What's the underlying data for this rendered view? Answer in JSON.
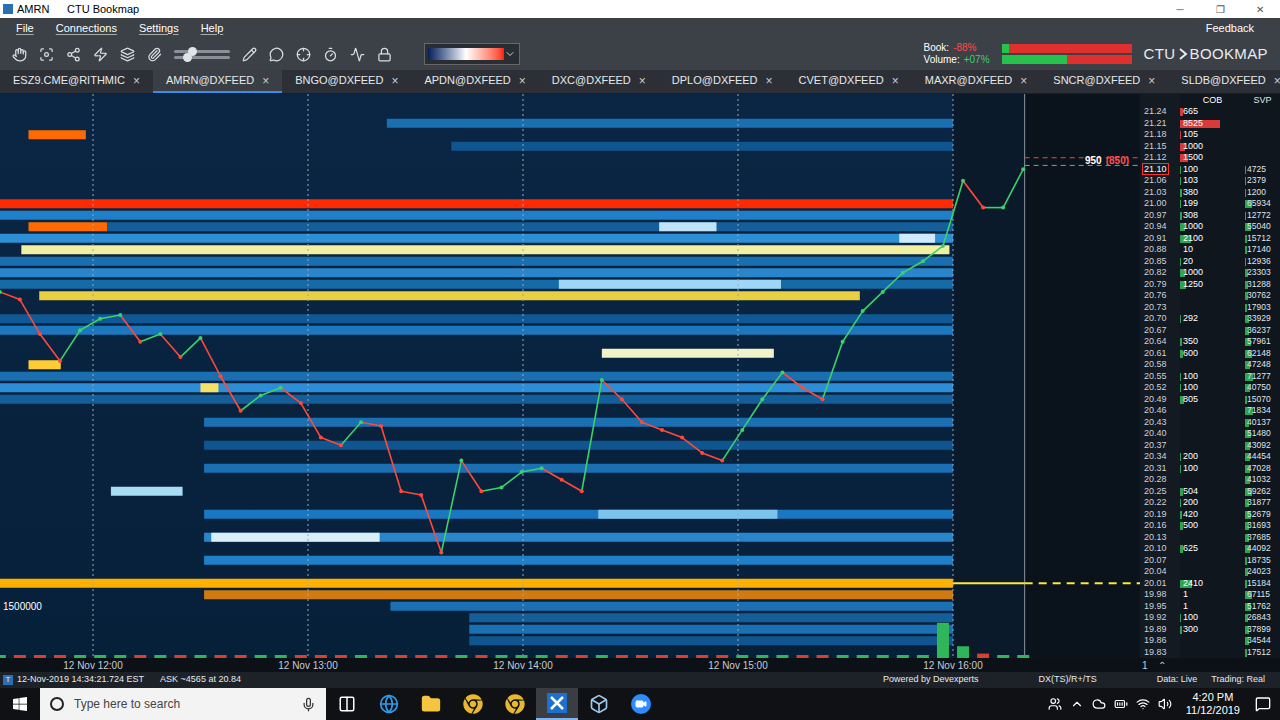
{
  "window": {
    "title": "AMRN",
    "app": "CTU Bookmap",
    "controls": [
      "─",
      "❐",
      "✕"
    ]
  },
  "menu": {
    "items": [
      "File",
      "Connections",
      "Settings",
      "Help"
    ],
    "feedback": "Feedback"
  },
  "toolbar": {
    "sliders": [
      {
        "level": 0.3
      },
      {
        "level": 0.2
      }
    ],
    "book_label": "Book:",
    "book_value": "-88%",
    "volume_label": "Volume:",
    "volume_value": "+07%",
    "book_buy_level": 0.06,
    "volume_buy_level": 0.5,
    "logo_left": "CTU",
    "logo_right": "BOOKMAP"
  },
  "tabs": [
    {
      "label": "ESZ9.CME@RITHMIC",
      "selected": false
    },
    {
      "label": "AMRN@DXFEED",
      "selected": true
    },
    {
      "label": "BNGO@DXFEED",
      "selected": false
    },
    {
      "label": "APDN@DXFEED",
      "selected": false
    },
    {
      "label": "DXC@DXFEED",
      "selected": false
    },
    {
      "label": "DPLO@DXFEED",
      "selected": false
    },
    {
      "label": "CVET@DXFEED",
      "selected": false
    },
    {
      "label": "MAXR@DXFEED",
      "selected": false
    },
    {
      "label": "SNCR@DXFEED",
      "selected": false
    },
    {
      "label": "SLDB@DXFEED",
      "selected": false
    }
  ],
  "tab_close": "×",
  "tab_add": "+",
  "ladder": {
    "headers": [
      "COB",
      "SVP"
    ],
    "rows": [
      {
        "price": "21.24",
        "cob": "665",
        "svp": "",
        "side": "ask",
        "highlight": false
      },
      {
        "price": "21.21",
        "cob": "8525",
        "svp": "",
        "side": "ask",
        "highlight": false
      },
      {
        "price": "21.18",
        "cob": "105",
        "svp": "",
        "side": "ask",
        "highlight": false
      },
      {
        "price": "21.15",
        "cob": "1000",
        "svp": "",
        "side": "ask",
        "highlight": false
      },
      {
        "price": "21.12",
        "cob": "1500",
        "svp": "",
        "side": "ask",
        "highlight": false
      },
      {
        "price": "21.10",
        "cob": "100",
        "svp": "4725",
        "side": "bid",
        "highlight": true
      },
      {
        "price": "21.06",
        "cob": "103",
        "svp": "2379",
        "side": "bid",
        "highlight": false
      },
      {
        "price": "21.03",
        "cob": "380",
        "svp": "1200",
        "side": "bid",
        "highlight": false
      },
      {
        "price": "21.00",
        "cob": "199",
        "svp": "65934",
        "side": "bid",
        "highlight": false
      },
      {
        "price": "20.97",
        "cob": "308",
        "svp": "12772",
        "side": "bid",
        "highlight": false
      },
      {
        "price": "20.94",
        "cob": "1000",
        "svp": "55040",
        "side": "bid",
        "highlight": false
      },
      {
        "price": "20.91",
        "cob": "2100",
        "svp": "15712",
        "side": "bid",
        "highlight": false
      },
      {
        "price": "20.88",
        "cob": "10",
        "svp": "17140",
        "side": "bid",
        "highlight": false
      },
      {
        "price": "20.85",
        "cob": "20",
        "svp": "12936",
        "side": "bid",
        "highlight": false
      },
      {
        "price": "20.82",
        "cob": "1000",
        "svp": "23303",
        "side": "bid",
        "highlight": false
      },
      {
        "price": "20.79",
        "cob": "1250",
        "svp": "31288",
        "side": "bid",
        "highlight": false
      },
      {
        "price": "20.76",
        "cob": "",
        "svp": "30762",
        "side": "bid",
        "highlight": false
      },
      {
        "price": "20.73",
        "cob": "",
        "svp": "17903",
        "side": "bid",
        "highlight": false
      },
      {
        "price": "20.70",
        "cob": "292",
        "svp": "33929",
        "side": "bid",
        "highlight": false
      },
      {
        "price": "20.67",
        "cob": "",
        "svp": "36237",
        "side": "bid",
        "highlight": false
      },
      {
        "price": "20.64",
        "cob": "350",
        "svp": "57961",
        "side": "bid",
        "highlight": false
      },
      {
        "price": "20.61",
        "cob": "600",
        "svp": "62148",
        "side": "bid",
        "highlight": false
      },
      {
        "price": "20.58",
        "cob": "",
        "svp": "47248",
        "side": "bid",
        "highlight": false
      },
      {
        "price": "20.55",
        "cob": "100",
        "svp": "71277",
        "side": "bid",
        "highlight": false
      },
      {
        "price": "20.52",
        "cob": "100",
        "svp": "40750",
        "side": "bid",
        "highlight": false
      },
      {
        "price": "20.49",
        "cob": "805",
        "svp": "15070",
        "side": "bid",
        "highlight": false
      },
      {
        "price": "20.46",
        "cob": "",
        "svp": "71834",
        "side": "bid",
        "highlight": false
      },
      {
        "price": "20.43",
        "cob": "",
        "svp": "40137",
        "side": "bid",
        "highlight": false
      },
      {
        "price": "20.40",
        "cob": "",
        "svp": "51480",
        "side": "bid",
        "highlight": false
      },
      {
        "price": "20.37",
        "cob": "",
        "svp": "43092",
        "side": "bid",
        "highlight": false
      },
      {
        "price": "20.34",
        "cob": "200",
        "svp": "44454",
        "side": "bid",
        "highlight": false
      },
      {
        "price": "20.31",
        "cob": "100",
        "svp": "47028",
        "side": "bid",
        "highlight": false
      },
      {
        "price": "20.28",
        "cob": "",
        "svp": "41032",
        "side": "bid",
        "highlight": false
      },
      {
        "price": "20.25",
        "cob": "504",
        "svp": "59262",
        "side": "bid",
        "highlight": false
      },
      {
        "price": "20.22",
        "cob": "200",
        "svp": "31877",
        "side": "bid",
        "highlight": false
      },
      {
        "price": "20.19",
        "cob": "420",
        "svp": "52679",
        "side": "bid",
        "highlight": false
      },
      {
        "price": "20.16",
        "cob": "500",
        "svp": "31693",
        "side": "bid",
        "highlight": false
      },
      {
        "price": "20.13",
        "cob": "",
        "svp": "37685",
        "side": "bid",
        "highlight": false
      },
      {
        "price": "20.10",
        "cob": "625",
        "svp": "44092",
        "side": "bid",
        "highlight": false
      },
      {
        "price": "20.07",
        "cob": "",
        "svp": "18735",
        "side": "bid",
        "highlight": false
      },
      {
        "price": "20.04",
        "cob": "",
        "svp": "24023",
        "side": "bid",
        "highlight": false
      },
      {
        "price": "20.01",
        "cob": "2410",
        "svp": "15184",
        "side": "bid",
        "highlight": false
      },
      {
        "price": "19.98",
        "cob": "1",
        "svp": "67115",
        "side": "bid",
        "highlight": false
      },
      {
        "price": "19.95",
        "cob": "1",
        "svp": "51762",
        "side": "bid",
        "highlight": false
      },
      {
        "price": "19.92",
        "cob": "100",
        "svp": "26843",
        "side": "bid",
        "highlight": false
      },
      {
        "price": "19.89",
        "cob": "300",
        "svp": "37899",
        "side": "bid",
        "highlight": false
      },
      {
        "price": "19.86",
        "cob": "",
        "svp": "34544",
        "side": "bid",
        "highlight": false
      },
      {
        "price": "19.83",
        "cob": "",
        "svp": "17512",
        "side": "bid",
        "highlight": false
      }
    ]
  },
  "chart": {
    "price_series": {
      "start_minute": -26,
      "step_minutes": 5.6,
      "values": [
        20.77,
        20.75,
        20.66,
        20.59,
        20.67,
        20.7,
        20.71,
        20.64,
        20.66,
        20.6,
        20.65,
        20.55,
        20.46,
        20.5,
        20.52,
        20.48,
        20.39,
        20.37,
        20.43,
        20.42,
        20.25,
        20.24,
        20.09,
        20.33,
        20.25,
        20.26,
        20.3,
        20.31,
        20.28,
        20.25,
        20.54,
        20.49,
        20.43,
        20.41,
        20.39,
        20.35,
        20.33,
        20.41,
        20.49,
        20.56,
        20.52,
        20.49,
        20.64,
        20.72,
        20.77,
        20.82,
        20.85,
        20.89,
        21.06,
        20.99,
        20.99,
        21.09
      ]
    },
    "volume": [
      30000,
      45000,
      20000,
      60000,
      25000,
      35000,
      40000,
      20000,
      30000,
      25000,
      55000,
      70000,
      30000,
      20000,
      25000,
      40000,
      35000,
      30000,
      45000,
      20000,
      60000,
      50000,
      65000,
      40000,
      30000,
      25000,
      20000,
      35000,
      30000,
      25000,
      60000,
      30000,
      25000,
      20000,
      30000,
      35000,
      25000,
      20000,
      30000,
      35000,
      40000,
      30000,
      45000,
      50000,
      60000,
      45000,
      50000,
      1200000,
      400000,
      150000,
      90000,
      60000
    ],
    "volume_scale_label": "1500000",
    "bands": [
      {
        "price": 21.21,
        "from": 82,
        "to": 240,
        "color": "#1a6fb0"
      },
      {
        "price": 21.18,
        "from": -18,
        "to": -2,
        "color": "#ff6a00"
      },
      {
        "price": 21.15,
        "from": 100,
        "to": 240,
        "color": "#0f5590"
      },
      {
        "price": 21.0,
        "from": -26,
        "to": 240,
        "color": "#ff2a00"
      },
      {
        "price": 20.97,
        "from": -26,
        "to": 240,
        "color": "#1f7fc8"
      },
      {
        "price": 20.94,
        "from": -18,
        "to": 4,
        "color": "#ff6a00"
      },
      {
        "price": 20.94,
        "from": 4,
        "to": 240,
        "color": "#145f9a"
      },
      {
        "price": 20.94,
        "from": 158,
        "to": 174,
        "color": "#bfe4f8"
      },
      {
        "price": 20.91,
        "from": -26,
        "to": 240,
        "color": "#2d8fd6"
      },
      {
        "price": 20.91,
        "from": 225,
        "to": 235,
        "color": "#cfeaff"
      },
      {
        "price": 20.88,
        "from": -20,
        "to": 239,
        "color": "#f0f0a0"
      },
      {
        "price": 20.85,
        "from": -26,
        "to": 240,
        "color": "#1a6fb0"
      },
      {
        "price": 20.82,
        "from": -26,
        "to": 240,
        "color": "#2a86cc"
      },
      {
        "price": 20.79,
        "from": -26,
        "to": 240,
        "color": "#156aa8"
      },
      {
        "price": 20.79,
        "from": 130,
        "to": 192,
        "color": "#9fd6f5"
      },
      {
        "price": 20.76,
        "from": -15,
        "to": 214,
        "color": "#e8d040"
      },
      {
        "price": 20.7,
        "from": -26,
        "to": 240,
        "color": "#0f5a96"
      },
      {
        "price": 20.67,
        "from": -26,
        "to": 240,
        "color": "#1b78bf"
      },
      {
        "price": 20.61,
        "from": 142,
        "to": 190,
        "color": "#f2f2c8"
      },
      {
        "price": 20.58,
        "from": -18,
        "to": -9,
        "color": "#ffcc33"
      },
      {
        "price": 20.55,
        "from": -26,
        "to": 240,
        "color": "#1a6fb0"
      },
      {
        "price": 20.52,
        "from": -26,
        "to": 240,
        "color": "#2c8ed6"
      },
      {
        "price": 20.52,
        "from": 30,
        "to": 35,
        "color": "#f5e16a"
      },
      {
        "price": 20.49,
        "from": -26,
        "to": 240,
        "color": "#145f9a"
      },
      {
        "price": 20.43,
        "from": 31,
        "to": 240,
        "color": "#1a70b2"
      },
      {
        "price": 20.37,
        "from": 31,
        "to": 240,
        "color": "#0f5590"
      },
      {
        "price": 20.31,
        "from": 31,
        "to": 240,
        "color": "#1a70b2"
      },
      {
        "price": 20.25,
        "from": 5,
        "to": 25,
        "color": "#a8dcf5"
      },
      {
        "price": 20.19,
        "from": 31,
        "to": 240,
        "color": "#1a78c2"
      },
      {
        "price": 20.19,
        "from": 141,
        "to": 191,
        "color": "#7cc4ec"
      },
      {
        "price": 20.13,
        "from": 31,
        "to": 240,
        "color": "#2a86cc"
      },
      {
        "price": 20.13,
        "from": 33,
        "to": 80,
        "color": "#d8eef9"
      },
      {
        "price": 20.07,
        "from": 31,
        "to": 240,
        "color": "#1f7fc8"
      },
      {
        "price": 20.01,
        "from": -26,
        "to": 240,
        "color": "#ffb000"
      },
      {
        "price": 19.98,
        "from": 31,
        "to": 240,
        "color": "#d07a10"
      },
      {
        "price": 19.95,
        "from": 83,
        "to": 240,
        "color": "#1a70b2"
      },
      {
        "price": 19.92,
        "from": 105,
        "to": 240,
        "color": "#145f9a"
      },
      {
        "price": 19.89,
        "from": 105,
        "to": 240,
        "color": "#1a70b2"
      },
      {
        "price": 19.86,
        "from": 105,
        "to": 240,
        "color": "#0f5590"
      }
    ],
    "time_ticks": [
      {
        "label": "12 Nov 12:00",
        "minute": 0
      },
      {
        "label": "12 Nov 13:00",
        "minute": 60
      },
      {
        "label": "12 Nov 14:00",
        "minute": 120
      },
      {
        "label": "12 Nov 15:00",
        "minute": 180
      },
      {
        "label": "12 Nov 16:00",
        "minute": 240
      }
    ],
    "now_minute": 260,
    "ask_line": 21.12,
    "bid_line": 21.1,
    "marked_level": 20.01,
    "order_label": {
      "size": "950",
      "pending": "(850)"
    },
    "axis_controls": [
      "1",
      "⌃"
    ]
  },
  "status_bar": {
    "icon": "T",
    "time": "12-Nov-2019 14:34:21.724 EST",
    "ask": "ASK ~4565 at 20.84",
    "powered": "Powered by Devexperts",
    "feed": "DX(TS)/R+/TS",
    "data": "Data: Live",
    "trading": "Trading: Real"
  },
  "taskbar": {
    "search_placeholder": "Type here to search",
    "time": "4:20 PM",
    "date": "11/12/2019",
    "apps": [
      {
        "kind": "taskview",
        "selected": false
      },
      {
        "kind": "edge",
        "selected": false
      },
      {
        "kind": "explorer",
        "selected": false
      },
      {
        "kind": "chrome",
        "selected": false
      },
      {
        "kind": "chrome",
        "selected": false
      },
      {
        "kind": "bookmap",
        "selected": true
      },
      {
        "kind": "box",
        "selected": false
      },
      {
        "kind": "zoom",
        "selected": false
      }
    ]
  }
}
